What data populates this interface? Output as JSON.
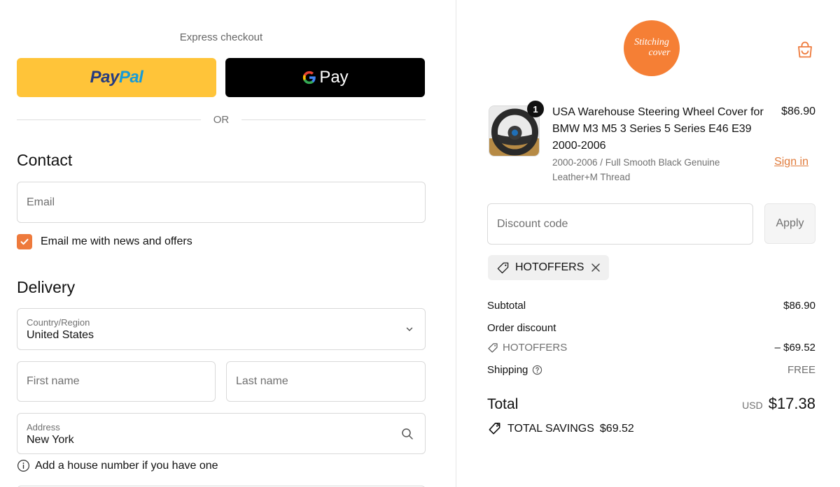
{
  "express": {
    "title": "Express checkout",
    "paypal_part1": "Pay",
    "paypal_part2": "Pal",
    "gpay_label": "Pay",
    "or_label": "OR"
  },
  "contact": {
    "heading": "Contact",
    "sign_in": "Sign in",
    "email_placeholder": "Email",
    "newsletter_label": "Email me with news and offers",
    "newsletter_checked": true
  },
  "delivery": {
    "heading": "Delivery",
    "country_label": "Country/Region",
    "country_value": "United States",
    "first_name_placeholder": "First name",
    "last_name_placeholder": "Last name",
    "address_label": "Address",
    "address_value": "New York",
    "address_hint": "Add a house number if you have one"
  },
  "store": {
    "logo_line1": "Stitching",
    "logo_line2": "cover",
    "accent_color": "#f57f35"
  },
  "cart": {
    "item": {
      "quantity": "1",
      "title": "USA Warehouse Steering Wheel Cover for BMW M3 M5 3 Series 5 Series E46 E39 2000-2006",
      "variant": "2000-2006 / Full Smooth Black Genuine Leather+M Thread",
      "price": "$86.90"
    },
    "discount_placeholder": "Discount code",
    "apply_label": "Apply",
    "applied_code": "HOTOFFERS"
  },
  "summary": {
    "subtotal_label": "Subtotal",
    "subtotal_value": "$86.90",
    "order_discount_label": "Order discount",
    "discount_code": "HOTOFFERS",
    "discount_value": "– $69.52",
    "shipping_label": "Shipping",
    "shipping_value": "FREE",
    "total_label": "Total",
    "currency": "USD",
    "total_value": "$17.38",
    "savings_label": "TOTAL SAVINGS",
    "savings_value": "$69.52"
  }
}
